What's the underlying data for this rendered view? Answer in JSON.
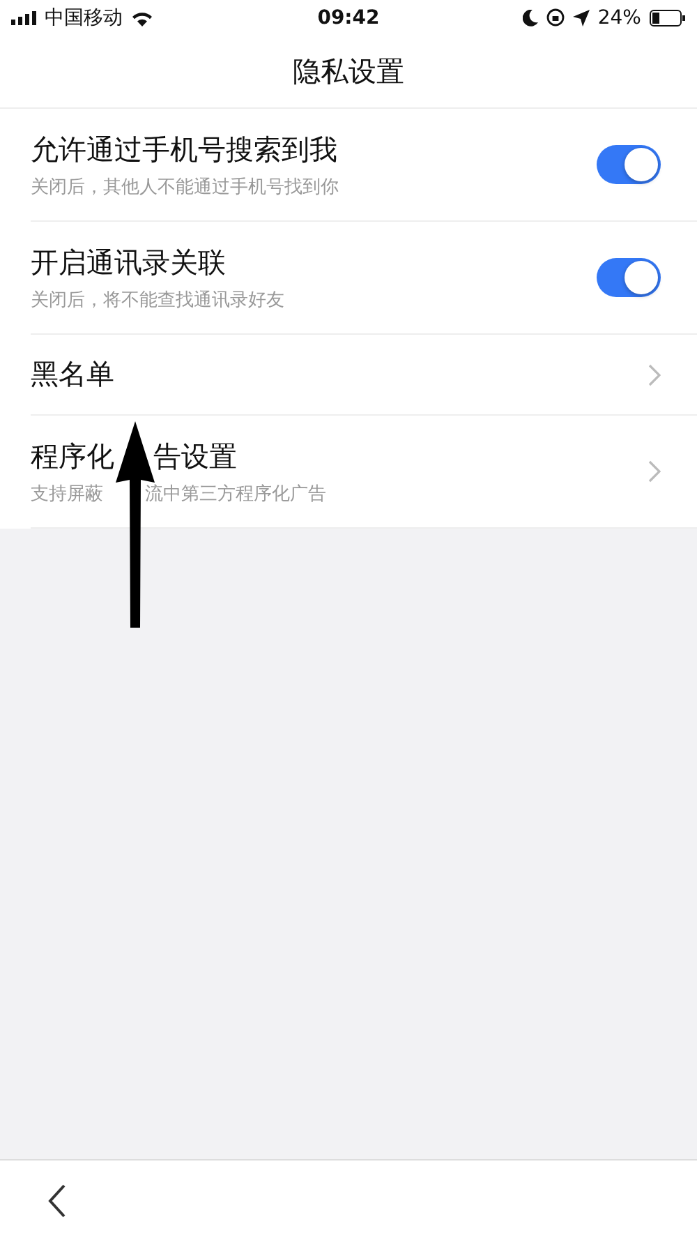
{
  "status_bar": {
    "carrier": "中国移动",
    "time": "09:42",
    "battery": "24%"
  },
  "nav": {
    "title": "隐私设置"
  },
  "settings": [
    {
      "kind": "toggle",
      "title": "允许通过手机号搜索到我",
      "subtitle": "关闭后，其他人不能通过手机号找到你",
      "on": true
    },
    {
      "kind": "toggle",
      "title": "开启通讯录关联",
      "subtitle": "关闭后，将不能查找通讯录好友",
      "on": true
    },
    {
      "kind": "link",
      "title": "黑名单"
    },
    {
      "kind": "link",
      "title_parts": [
        "程序化",
        "告设置"
      ],
      "subtitle_parts": [
        "支持屏蔽",
        "流中第三方程序化广告"
      ]
    }
  ]
}
